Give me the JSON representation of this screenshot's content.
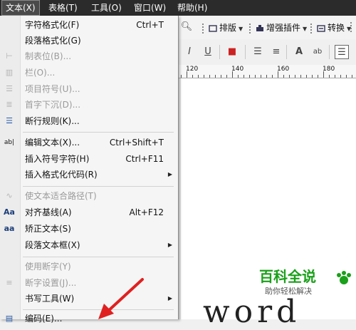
{
  "menubar": {
    "items": [
      {
        "label": "文本(X)",
        "active": true
      },
      {
        "label": "表格(T)"
      },
      {
        "label": "工具(O)"
      },
      {
        "label": "窗口(W)"
      },
      {
        "label": "帮助(H)"
      }
    ]
  },
  "toolbar": {
    "buttons": [
      {
        "label": "排版",
        "icon": "layout-icon"
      },
      {
        "label": "增强插件",
        "icon": "plugin-icon"
      },
      {
        "label": "转换",
        "icon": "convert-icon"
      }
    ]
  },
  "ruler": {
    "labels": [
      "120",
      "140",
      "160",
      "180"
    ]
  },
  "text_menu": {
    "items": [
      {
        "label": "字符格式化(F)",
        "shortcut": "Ctrl+T",
        "icon": "",
        "disabled": false
      },
      {
        "label": "段落格式化(G)",
        "shortcut": "",
        "icon": "",
        "disabled": false
      },
      {
        "label": "制表位(B)...",
        "shortcut": "",
        "icon": "tab-stop-icon",
        "disabled": true
      },
      {
        "label": "栏(O)...",
        "shortcut": "",
        "icon": "columns-icon",
        "disabled": true
      },
      {
        "label": "项目符号(U)...",
        "shortcut": "",
        "icon": "bullets-icon",
        "disabled": true
      },
      {
        "label": "首字下沉(D)...",
        "shortcut": "",
        "icon": "drop-cap-icon",
        "disabled": true
      },
      {
        "label": "断行规则(K)...",
        "shortcut": "",
        "icon": "line-break-icon",
        "disabled": false
      },
      {
        "label": "编辑文本(X)...",
        "shortcut": "Ctrl+Shift+T",
        "icon": "edit-text-icon",
        "disabled": false
      },
      {
        "label": "插入符号字符(H)",
        "shortcut": "Ctrl+F11",
        "icon": "",
        "disabled": false
      },
      {
        "label": "插入格式化代码(R)",
        "shortcut": "",
        "icon": "",
        "disabled": false,
        "submenu": true
      },
      {
        "label": "使文本适合路径(T)",
        "shortcut": "",
        "icon": "fit-path-icon",
        "disabled": true
      },
      {
        "label": "对齐基线(A)",
        "shortcut": "Alt+F12",
        "icon": "align-baseline-icon",
        "disabled": false
      },
      {
        "label": "矫正文本(S)",
        "shortcut": "",
        "icon": "straighten-text-icon",
        "disabled": false
      },
      {
        "label": "段落文本框(X)",
        "shortcut": "",
        "icon": "",
        "disabled": false,
        "submenu": true
      },
      {
        "label": "使用断字(Y)",
        "shortcut": "",
        "icon": "",
        "disabled": true
      },
      {
        "label": "断字设置(J)...",
        "shortcut": "",
        "icon": "hyphenation-icon",
        "disabled": true
      },
      {
        "label": "书写工具(W)",
        "shortcut": "",
        "icon": "",
        "disabled": false,
        "submenu": true
      },
      {
        "label": "编码(E)...",
        "shortcut": "",
        "icon": "encoding-icon",
        "disabled": false
      }
    ]
  },
  "canvas": {
    "text": "word"
  },
  "watermark": {
    "title": "百科全说",
    "subtitle": "助你轻松解决"
  },
  "colors": {
    "menubar_bg": "#2b2b2b",
    "watermark_green": "#1aa01a",
    "arrow_red": "#e02020"
  }
}
